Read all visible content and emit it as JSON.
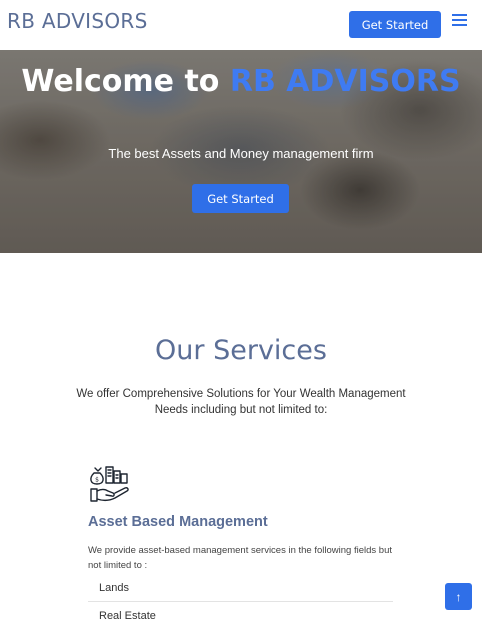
{
  "header": {
    "logo": "RB ADVISORS",
    "cta_label": "Get Started",
    "menu_icon": "hamburger-menu-icon"
  },
  "hero": {
    "title_prefix": "Welcome to ",
    "title_accent": "RB ADVISORS",
    "subtitle": "The best Assets and Money management firm",
    "cta_label": "Get Started"
  },
  "services": {
    "title": "Our Services",
    "description": "We offer Comprehensive Solutions for Your Wealth Management Needs including but not limited to:",
    "items": [
      {
        "icon": "asset-hand-icon",
        "title": "Asset Based Management",
        "description": "We provide asset-based management services in the following fields but not limited to :",
        "fields": [
          "Lands",
          "Real Estate"
        ]
      }
    ]
  },
  "back_to_top": {
    "icon": "arrow-up-icon"
  },
  "colors": {
    "accent": "#2f6fe8",
    "heading": "#5b6e96"
  }
}
